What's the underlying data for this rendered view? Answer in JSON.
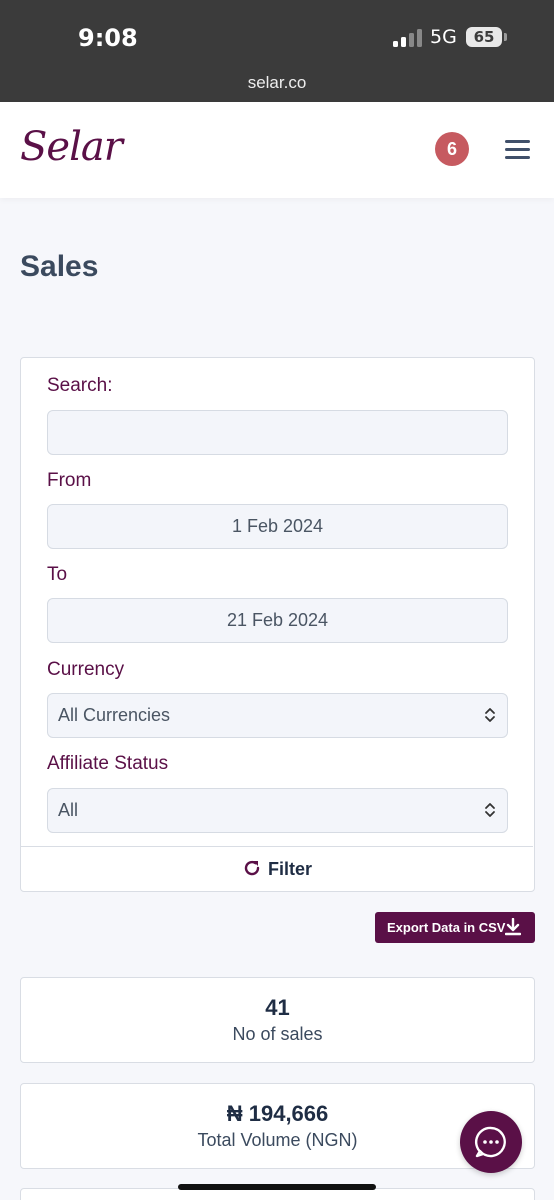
{
  "status_bar": {
    "time": "9:08",
    "network": "5G",
    "battery": "65",
    "url": "selar.co"
  },
  "header": {
    "logo": "Selar",
    "notification_count": "6"
  },
  "page": {
    "title": "Sales"
  },
  "filters": {
    "search_label": "Search:",
    "search_value": "",
    "from_label": "From",
    "from_value": "1 Feb 2024",
    "to_label": "To",
    "to_value": "21 Feb 2024",
    "currency_label": "Currency",
    "currency_value": "All Currencies",
    "affiliate_label": "Affiliate Status",
    "affiliate_value": "All",
    "filter_button": "Filter"
  },
  "export_button": "Export Data in CSV",
  "stats": [
    {
      "value": "41",
      "caption": "No of sales"
    },
    {
      "value": "₦ 194,666",
      "caption": "Total Volume (NGN)"
    }
  ],
  "colors": {
    "brand": "#5a1047",
    "badge": "#c65a60"
  }
}
